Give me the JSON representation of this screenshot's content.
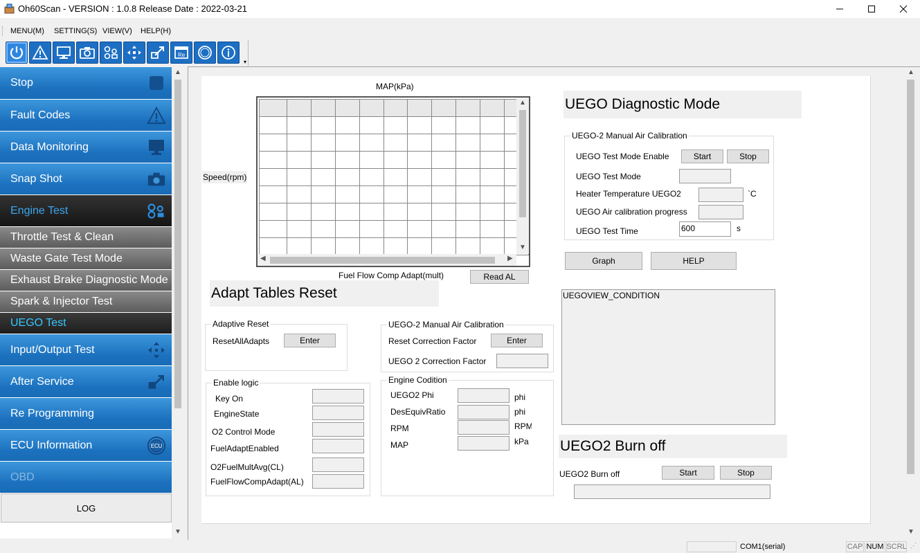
{
  "window": {
    "title": "Oh60Scan - VERSION : 1.0.8 Release Date : 2022-03-21",
    "minimize": "—",
    "maximize": "☐",
    "close": "✕"
  },
  "menu": [
    "MENU(M)",
    "SETTING(S)",
    "VIEW(V)",
    "HELP(H)"
  ],
  "toolbar_icons": [
    "power-icon",
    "warning-icon",
    "monitor-icon",
    "camera-icon",
    "engine-icon",
    "arrows-icon",
    "service-icon",
    "reprogram-icon",
    "ecu-icon",
    "info-icon"
  ],
  "sidebar": {
    "items": [
      {
        "label": "Stop",
        "icon": "stop-icon"
      },
      {
        "label": "Fault Codes",
        "icon": "warning-icon"
      },
      {
        "label": "Data Monitoring",
        "icon": "monitor-icon"
      },
      {
        "label": "Snap Shot",
        "icon": "camera-icon"
      },
      {
        "label": "Engine Test",
        "icon": "engine-icon"
      }
    ],
    "subitems": [
      "Throttle Test & Clean",
      "Waste Gate Test Mode",
      "Exhaust Brake Diagnostic Mode",
      "Spark & Injector Test",
      "UEGO Test"
    ],
    "items2": [
      {
        "label": "Input/Output Test",
        "icon": "arrows-icon"
      },
      {
        "label": "After Service",
        "icon": "service-icon"
      },
      {
        "label": "Re Programming",
        "icon": ""
      },
      {
        "label": "ECU Information",
        "icon": "ecu-icon"
      },
      {
        "label": "OBD",
        "icon": ""
      }
    ],
    "log": "LOG",
    "ecu_icon_text": "ECU"
  },
  "table_area": {
    "map_label": "MAP(kPa)",
    "speed_label": "Speed(rpm)",
    "fuel_label": "Fuel Flow Comp Adapt(mult)",
    "read_btn": "Read AL"
  },
  "uego_diag": {
    "heading": "UEGO Diagnostic Mode",
    "group_title": "UEGO-2 Manual Air Calibration",
    "test_mode_enable": "UEGO Test Mode Enable",
    "start": "Start",
    "stop": "Stop",
    "test_mode": "UEGO Test Mode",
    "heater_temp": "Heater Temperature UEGO2",
    "heater_unit": "`C",
    "air_cal_progress": "UEGO Air calibration progress",
    "test_time": "UEGO Test Time",
    "test_time_value": "600",
    "test_time_unit": "s",
    "graph_btn": "Graph",
    "help_btn": "HELP"
  },
  "condition_box": "UEGOVIEW_CONDITION",
  "adapt_reset": {
    "heading": "Adapt Tables Reset",
    "adaptive_reset_title": "Adaptive Reset",
    "reset_all": "ResetAllAdapts",
    "enter": "Enter",
    "manual_cal_title": "UEGO-2 Manual Air Calibration",
    "reset_correction": "Reset Correction Factor",
    "correction_factor": "UEGO 2 Correction Factor"
  },
  "enable_logic": {
    "title": "Enable logic",
    "fields": [
      "Key On",
      "EngineState",
      "O2 Control Mode",
      "FuelAdaptEnabled",
      "O2FuelMultAvg(CL)",
      "FuelFlowCompAdapt(AL)"
    ]
  },
  "engine_condition": {
    "title": "Engine Codition",
    "fields": [
      {
        "label": "UEGO2 Phi",
        "unit": "phi"
      },
      {
        "label": "DesEquivRatio",
        "unit": "phi"
      },
      {
        "label": "RPM",
        "unit": "RPM"
      },
      {
        "label": "MAP",
        "unit": "kPa"
      }
    ]
  },
  "burn_off": {
    "heading": "UEGO2 Burn off",
    "label": "UEGO2 Burn off",
    "start": "Start",
    "stop": "Stop"
  },
  "statusbar": {
    "port": "COM1(serial)",
    "cap": "CAP",
    "num": "NUM",
    "scrl": "SCRL"
  },
  "colors": {
    "nav_blue": "#1b70bd",
    "active_text": "#3aa6f0",
    "toolbar_blue": "#1d6fc4"
  }
}
